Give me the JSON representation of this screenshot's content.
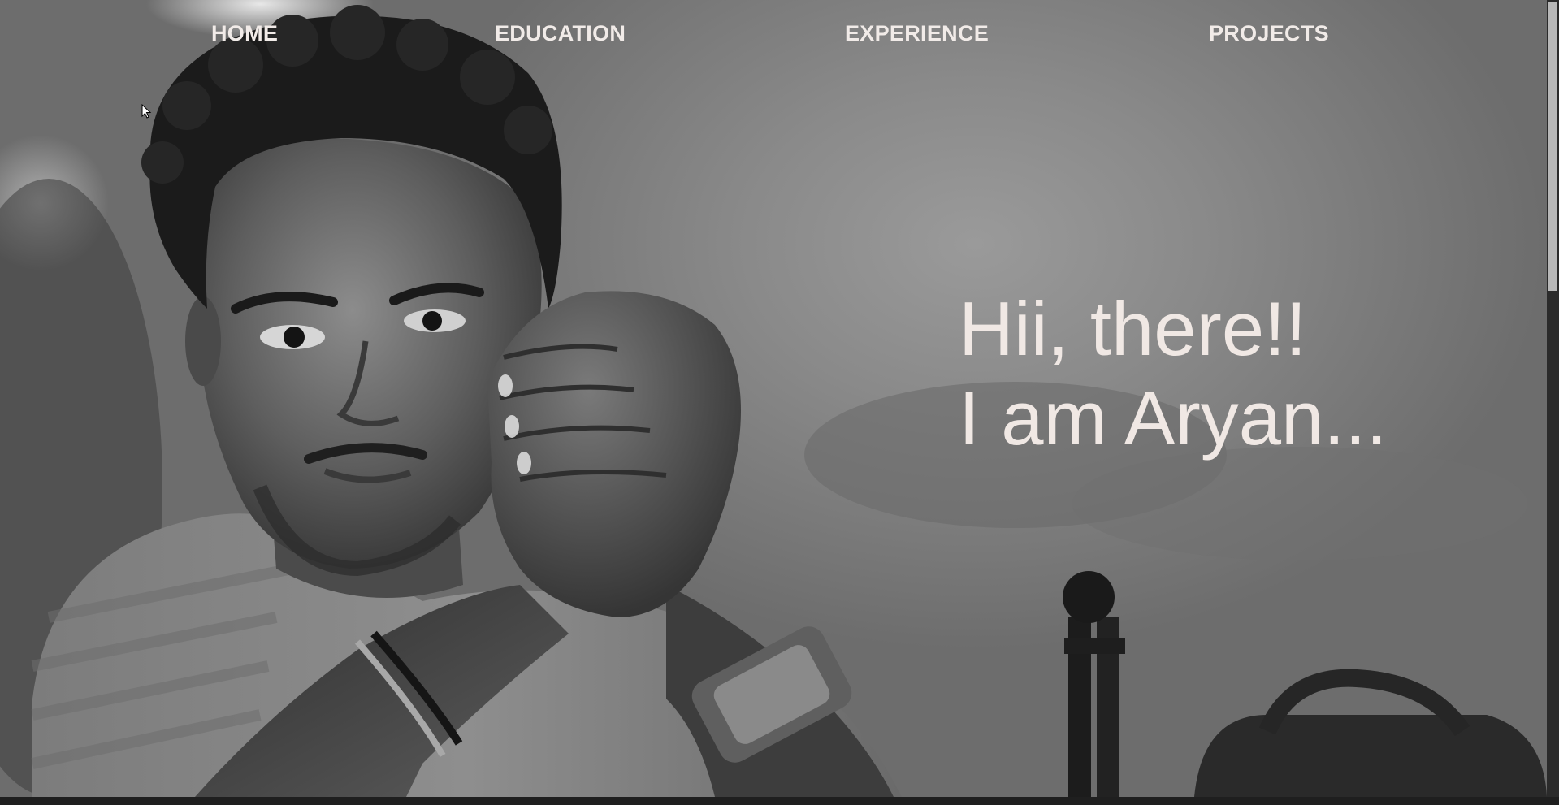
{
  "nav": {
    "home": "HOME",
    "education": "EDUCATION",
    "experience": "EXPERIENCE",
    "projects": "PROJECTS"
  },
  "hero": {
    "line1": "Hii, there!!",
    "line2": "I am Aryan..."
  },
  "image": {
    "subject": "portrait-photo-grayscale"
  },
  "colors": {
    "nav_text": "#f1ebe8",
    "hero_text": "#f0e8e4",
    "scrollbar_track": "#2b2b2b",
    "scrollbar_thumb": "#b8b8b8"
  }
}
